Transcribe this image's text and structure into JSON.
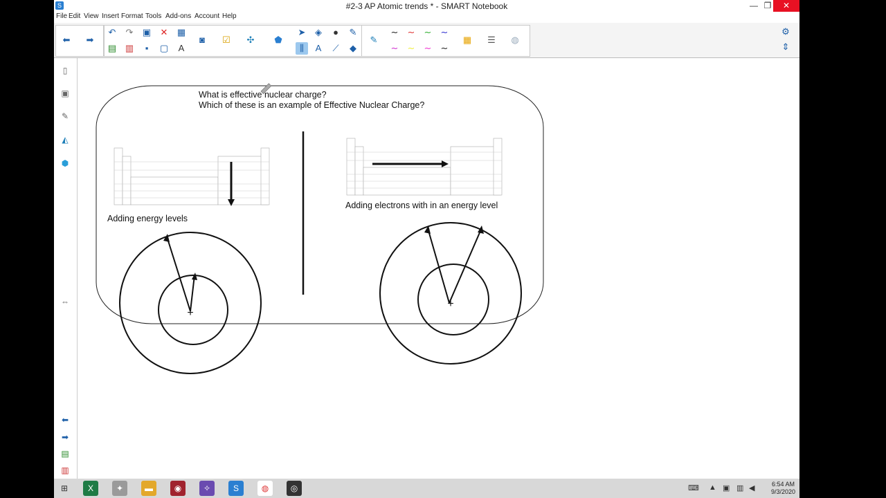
{
  "window": {
    "title": "#2-3 AP Atomic trends * - SMART Notebook",
    "controls": [
      "—",
      "❐",
      "✕"
    ]
  },
  "menu": [
    "File",
    "Edit",
    "View",
    "Insert",
    "Format",
    "Tools",
    "Add-ons",
    "Account",
    "Help"
  ],
  "toolbar": {
    "icons": [
      "back-arrow",
      "forward-arrow",
      "undo",
      "redo",
      "page",
      "delete",
      "table",
      "screen",
      "measure",
      "add-on",
      "pointer",
      "select",
      "shapes",
      "fill",
      "text",
      "line",
      "eraser",
      "pen",
      "lines",
      "colors",
      "properties",
      "more"
    ]
  },
  "sidebar": {
    "icons": [
      "page-sorter",
      "gallery",
      "attachments",
      "properties",
      "add-ons"
    ]
  },
  "slide": {
    "question1": "What is effective nuclear charge?",
    "question2": "Which of these is an example of Effective Nuclear Charge?",
    "left_caption": "Adding energy levels",
    "right_caption": "Adding electrons with in an energy level"
  },
  "taskbar": {
    "time": "6:54 AM",
    "date": "9/3/2020"
  },
  "colors": {
    "accent": "#2a7fd1",
    "close": "#e81123",
    "taskbar": "#d8d8d8"
  }
}
